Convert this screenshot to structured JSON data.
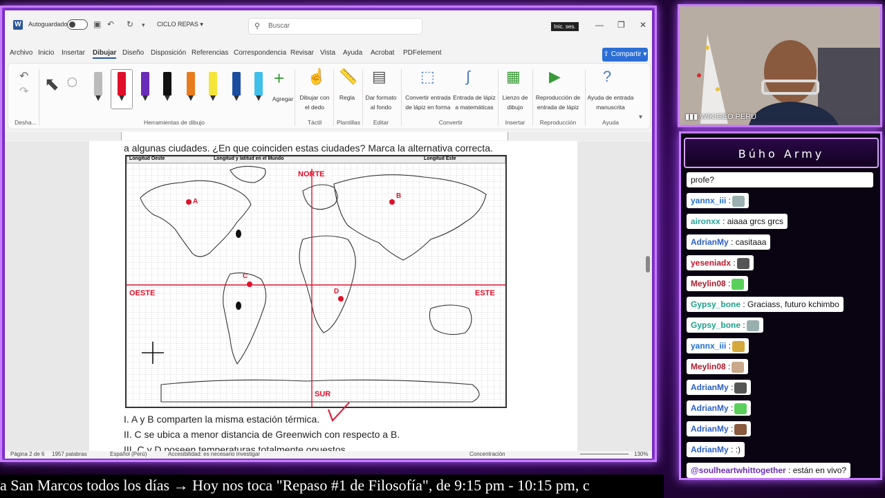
{
  "word": {
    "logo": "W",
    "autosave_label": "Autoguardado",
    "doc_name": "CICLO REPAS",
    "search_placeholder": "Buscar",
    "signin_label": "Inic. ses.",
    "menu": [
      "Archivo",
      "Inicio",
      "Insertar",
      "Dibujar",
      "Diseño",
      "Disposición",
      "Referencias",
      "Correspondencia",
      "Revisar",
      "Vista",
      "Ayuda",
      "Acrobat",
      "PDFelement"
    ],
    "active_menu": "Dibujar",
    "share_label": "Compartir",
    "ribbon": {
      "add_label": "Agregar",
      "draw_finger_label": "Dibujar con el dedo",
      "ruler_label": "Regla",
      "format_bg_label": "Dar formato al fondo",
      "ink_to_shape_label": "Convertir entrada de lápiz en forma",
      "ink_math_label": "Entrada de lápiz a matemáticas",
      "canvas_label": "Lienzo de dibujo",
      "replay_label": "Reproducción de entrada de lápiz",
      "handwriting_help_label": "Ayuda de entrada manuscrita",
      "groups": {
        "undo": "Desha...",
        "tools": "Herramientas de dibujo",
        "touch": "Táctil",
        "stencils": "Plantillas",
        "edit": "Editar",
        "convert": "Convertir",
        "insert": "Insertar",
        "replay": "Reproducción",
        "help": "Ayuda"
      }
    },
    "document": {
      "question_line": "a algunas ciudades. ¿En que coinciden estas ciudades? Marca la alternativa correcta.",
      "map": {
        "header_left": "Longitud Oeste",
        "header_center": "Longitud y latitud en el Mundo",
        "header_right": "Longitud Este",
        "north": "NORTE",
        "south": "SUR",
        "west": "OESTE",
        "east": "ESTE",
        "points": [
          "A",
          "B",
          "C",
          "D"
        ]
      },
      "answers": [
        "I. A y B comparten la misma estación térmica.",
        "II. C se ubica a menor distancia de Greenwich con respecto a B.",
        "III. C y D poseen temperaturas totalmente opuestos."
      ]
    },
    "status": {
      "page": "Página 2 de 6",
      "words": "1957 palabras",
      "language": "Español (Perú)",
      "accessibility": "Accesibilidad: es necesario investigar",
      "focus": "Concentración",
      "zoom": "130%"
    }
  },
  "ticker_text": "a San Marcos todos los días  →  Hoy nos toca \"Repaso #1 de Filosofía\", de 9:15 pm - 10:15 pm, c",
  "webcam": {
    "name": "WIKIGEO PERU"
  },
  "chat": {
    "title": "Búho Army",
    "partial_msg": "profe?",
    "messages": [
      {
        "user": "yannx_iii",
        "text": ":",
        "emote": true,
        "color": "#1f6fd0"
      },
      {
        "user": "aironxx",
        "text": ": aiaaa grcs grcs",
        "emote": false,
        "color": "#2aa59a"
      },
      {
        "user": "AdrianMy",
        "text": ": casitaaa",
        "emote": false,
        "color": "#2b5fc4"
      },
      {
        "user": "yeseniadx",
        "text": ":",
        "emote": true,
        "color": "#c0152a"
      },
      {
        "user": "Meylin08",
        "text": ":",
        "emote": true,
        "color": "#b01a2a"
      },
      {
        "user": "Gypsy_bone",
        "text": ": Graciass, futuro kchimbo",
        "emote": false,
        "color": "#1fa08a"
      },
      {
        "user": "Gypsy_bone",
        "text": ":",
        "emote": true,
        "color": "#1fa08a"
      },
      {
        "user": "yannx_iii",
        "text": ":",
        "emote": true,
        "color": "#1f6fd0"
      },
      {
        "user": "Meylin08",
        "text": ":",
        "emote": true,
        "color": "#b01a2a"
      },
      {
        "user": "AdrianMy",
        "text": ":",
        "emote": true,
        "color": "#2b5fc4"
      },
      {
        "user": "AdrianMy",
        "text": ":",
        "emote": true,
        "color": "#2b5fc4"
      },
      {
        "user": "AdrianMy",
        "text": ":",
        "emote": true,
        "color": "#2b5fc4"
      },
      {
        "user": "AdrianMy",
        "text": ": :)",
        "emote": false,
        "color": "#2b5fc4"
      },
      {
        "user": "@soulheartwhittogether",
        "text": ": están en vivo?",
        "emote": false,
        "color": "#6b2fb8"
      }
    ]
  },
  "colors": {
    "accent": "#c87cff",
    "word_blue": "#2b579a",
    "map_red": "#e0102a"
  }
}
